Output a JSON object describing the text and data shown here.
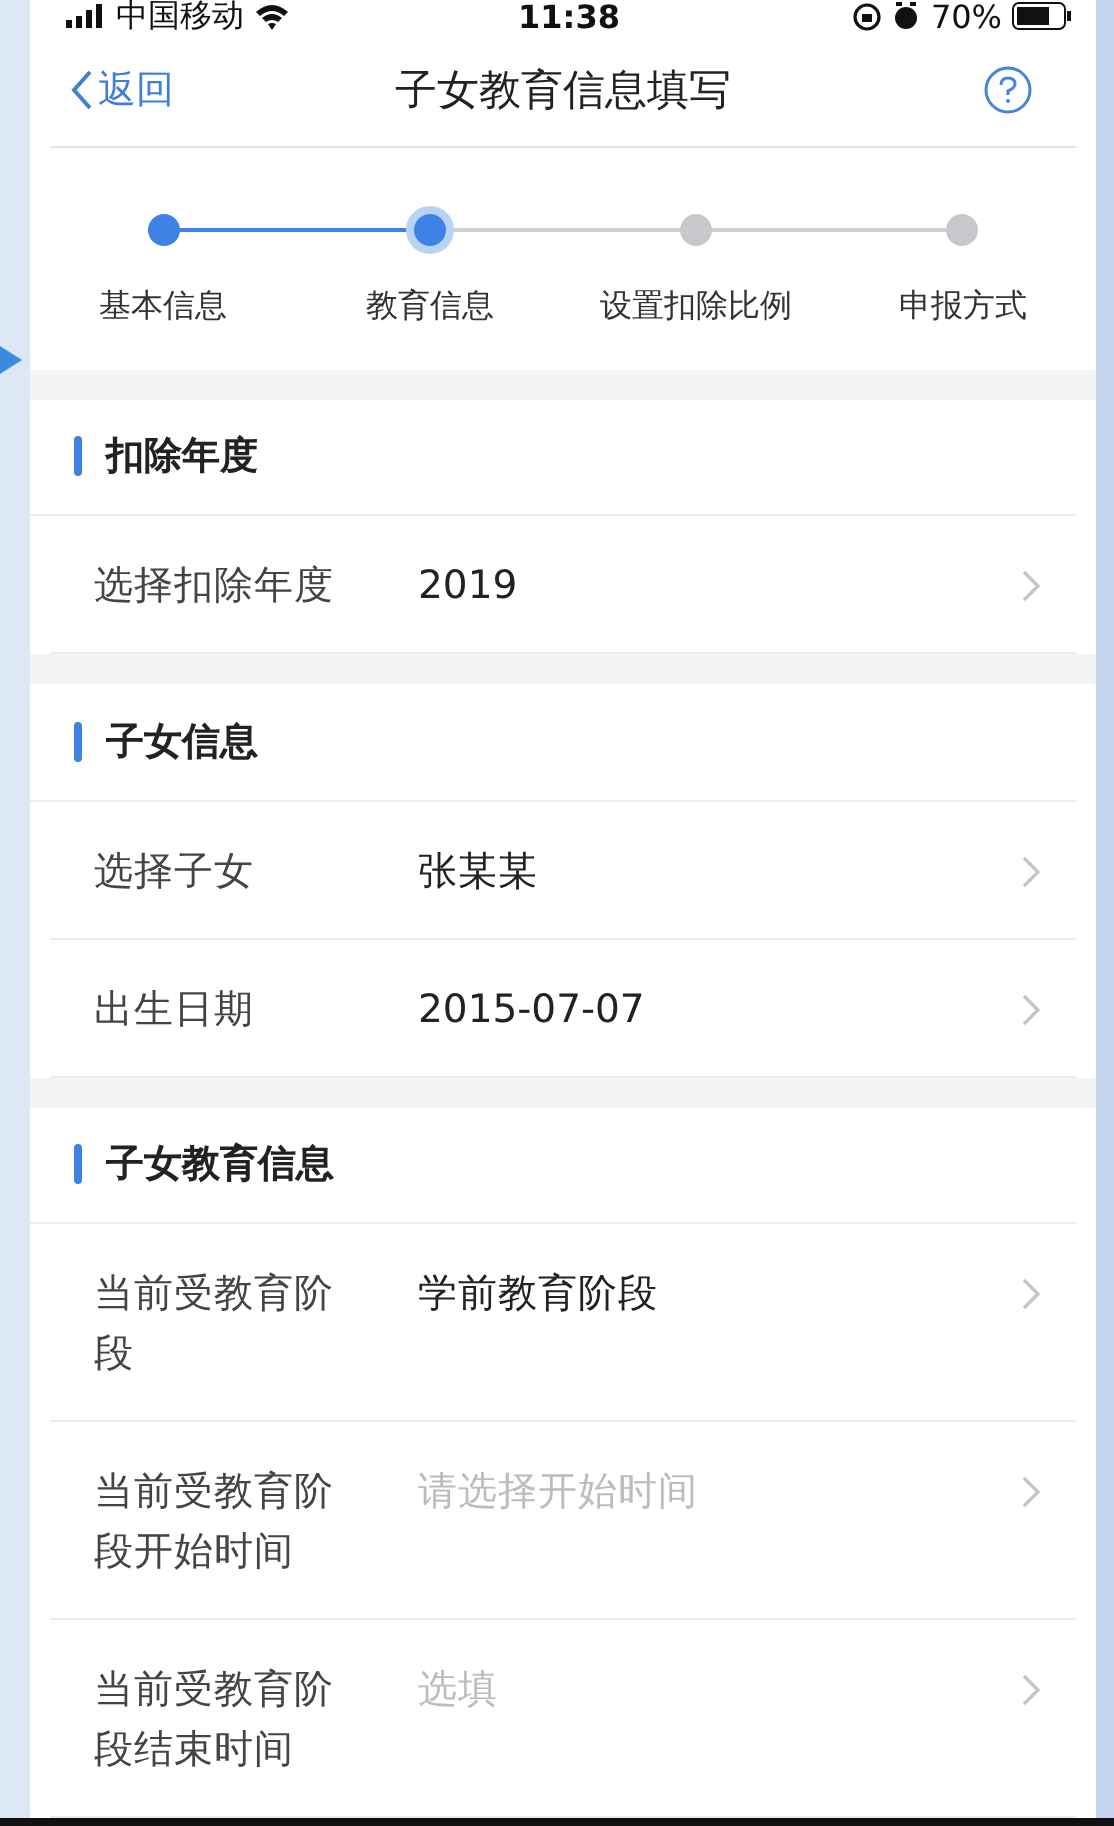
{
  "status_bar": {
    "carrier": "中国移动",
    "time": "11:38",
    "battery": "70%"
  },
  "nav": {
    "back": "返回",
    "title": "子女教育信息填写"
  },
  "steps": [
    {
      "label": "基本信息",
      "completed": true,
      "selected": false
    },
    {
      "label": "教育信息",
      "completed": false,
      "selected": true
    },
    {
      "label": "设置扣除比例",
      "completed": false,
      "selected": false
    },
    {
      "label": "申报方式",
      "completed": false,
      "selected": false
    }
  ],
  "sections": [
    {
      "title": "扣除年度",
      "rows": [
        {
          "label": "选择扣除年度",
          "value": "2019"
        }
      ]
    },
    {
      "title": "子女信息",
      "rows": [
        {
          "label": "选择子女",
          "value": "张某某"
        },
        {
          "label": "出生日期",
          "value": "2015-07-07"
        }
      ]
    },
    {
      "title": "子女教育信息",
      "rows": [
        {
          "label": "当前受教育阶段",
          "value": "学前教育阶段"
        },
        {
          "label": "当前受教育阶段开始时间",
          "placeholder": "请选择开始时间"
        },
        {
          "label": "当前受教育阶段结束时间",
          "placeholder": "选填"
        }
      ]
    }
  ]
}
